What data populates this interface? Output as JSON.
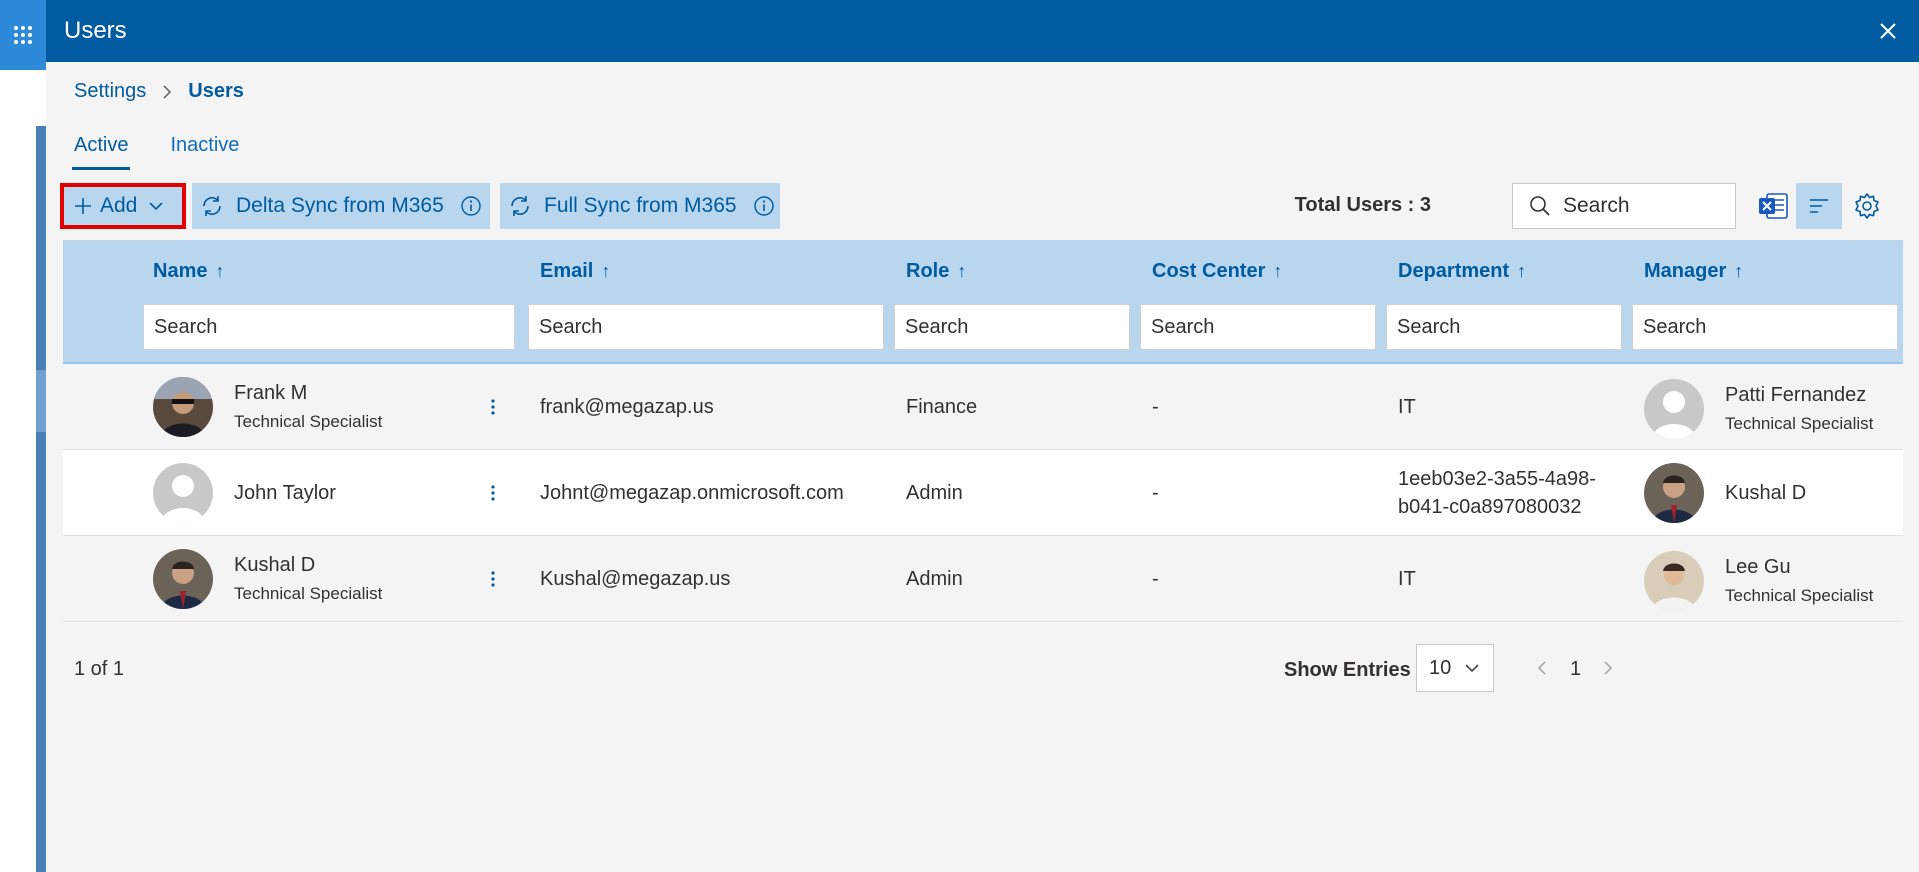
{
  "panel": {
    "title": "Users"
  },
  "breadcrumb": {
    "parent": "Settings",
    "current": "Users"
  },
  "tabs": [
    {
      "label": "Active"
    },
    {
      "label": "Inactive"
    }
  ],
  "toolbar": {
    "add_label": "Add",
    "delta_sync_label": "Delta Sync from M365",
    "full_sync_label": "Full Sync from M365",
    "total_users_label": "Total Users : 3",
    "search_placeholder": "Search"
  },
  "columns": [
    {
      "label": "Name",
      "sort": "↑"
    },
    {
      "label": "Email",
      "sort": "↑"
    },
    {
      "label": "Role",
      "sort": "↑"
    },
    {
      "label": "Cost Center",
      "sort": "↑"
    },
    {
      "label": "Department",
      "sort": "↑"
    },
    {
      "label": "Manager",
      "sort": "↑"
    }
  ],
  "filter_placeholder": "Search",
  "rows": [
    {
      "name": "Frank M",
      "title": "Technical Specialist",
      "email": "frank@megazap.us",
      "role": "Finance",
      "cost_center": "-",
      "department": "IT",
      "manager": {
        "name": "Patti Fernandez",
        "title": "Technical Specialist"
      }
    },
    {
      "name": "John Taylor",
      "title": "",
      "email": "Johnt@megazap.onmicrosoft.com",
      "role": "Admin",
      "cost_center": "-",
      "department_line1": "1eeb03e2-3a55-4a98-",
      "department_line2": "b041-c0a897080032",
      "manager": {
        "name": "Kushal D",
        "title": ""
      }
    },
    {
      "name": "Kushal D",
      "title": "Technical Specialist",
      "email": "Kushal@megazap.us",
      "role": "Admin",
      "cost_center": "-",
      "department": "IT",
      "manager": {
        "name": "Lee Gu",
        "title": "Technical Specialist"
      }
    }
  ],
  "footer": {
    "page_count": "1 of 1",
    "show_entries_label": "Show Entries",
    "entries_value": "10",
    "current_page": "1"
  },
  "colors": {
    "header": "#005ba1",
    "accent_light": "#b9d6ef",
    "highlight": "#e00000"
  }
}
